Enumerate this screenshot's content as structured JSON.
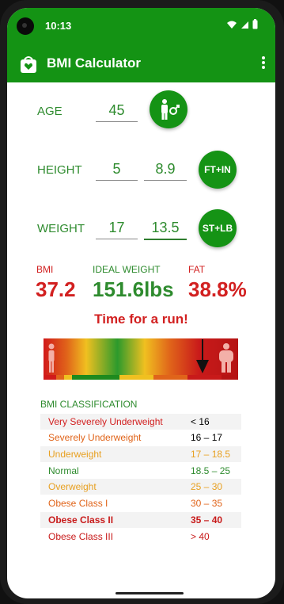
{
  "status": {
    "time": "10:13"
  },
  "app": {
    "title": "BMI Calculator"
  },
  "inputs": {
    "age": {
      "label": "AGE",
      "value": "45"
    },
    "height": {
      "label": "HEIGHT",
      "value1": "5",
      "value2": "8.9",
      "unit_button": "FT+IN"
    },
    "weight": {
      "label": "WEIGHT",
      "value1": "17",
      "value2": "13.5",
      "unit_button": "ST+LB"
    }
  },
  "results": {
    "bmi": {
      "label": "BMI",
      "value": "37.2"
    },
    "ideal": {
      "label": "IDEAL WEIGHT",
      "value": "151.6lbs"
    },
    "fat": {
      "label": "FAT",
      "value": "38.8%"
    }
  },
  "message": "Time for a run!",
  "classification": {
    "title": "BMI CLASSIFICATION",
    "rows": [
      {
        "name": "Very Severely Underweight",
        "range": "< 16",
        "color": "#d22020"
      },
      {
        "name": "Severely Underweight",
        "range": "16 – 17",
        "color": "#e0641a"
      },
      {
        "name": "Underweight",
        "range": "17 – 18.5",
        "color": "#e8a020"
      },
      {
        "name": "Normal",
        "range": "18.5 – 25",
        "color": "#2e8b2e"
      },
      {
        "name": "Overweight",
        "range": "25 – 30",
        "color": "#e8a020"
      },
      {
        "name": "Obese Class I",
        "range": "30 – 35",
        "color": "#e0641a"
      },
      {
        "name": "Obese Class II",
        "range": "35 – 40",
        "color": "#c81a1a"
      },
      {
        "name": "Obese Class III",
        "range": "> 40",
        "color": "#c81a1a"
      }
    ]
  },
  "colors": {
    "primary": "#149314",
    "label_green": "#2e8b2e",
    "alert_red": "#d22020"
  }
}
